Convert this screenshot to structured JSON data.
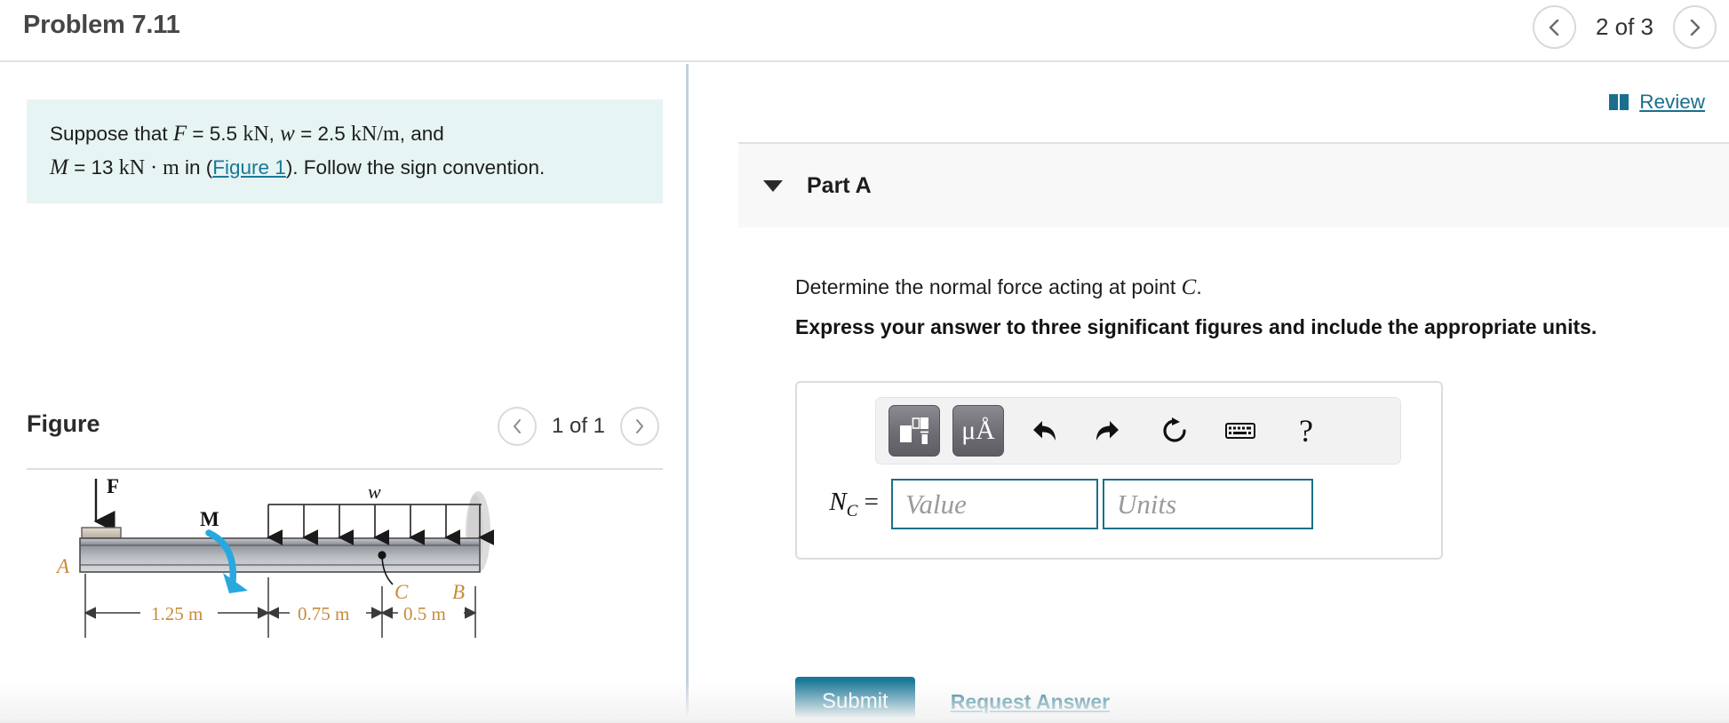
{
  "header": {
    "problem_title": "Problem 7.11",
    "prev_icon": "chevron-left-icon",
    "next_icon": "chevron-right-icon",
    "counter": "2 of 3"
  },
  "left_panel": {
    "statement": {
      "prefix": "Suppose that ",
      "var_F": "F",
      "eq1": " = 5.5 ",
      "unit_kN": "kN",
      "comma1": ", ",
      "var_w": "w",
      "eq2": " = 2.5 ",
      "unit_kNm": "kN/m",
      "and": ", and",
      "var_M": "M",
      "eq3": " = 13 ",
      "unit_kNdotm": "kN · m",
      "in_text": " in (",
      "figure_link": "Figure 1",
      "suffix": "). Follow the sign convention."
    },
    "figure": {
      "title": "Figure",
      "prev_icon": "chevron-left-icon",
      "next_icon": "chevron-right-icon",
      "counter": "1 of 1",
      "labels": {
        "force_F": "F",
        "moment_M": "M",
        "dist_load_w": "w",
        "point_A": "A",
        "point_B": "B",
        "point_C": "C",
        "dim1": "1.25 m",
        "dim2": "0.75 m",
        "dim3": "0.5 m"
      }
    }
  },
  "right_panel": {
    "review": {
      "icon": "book-icon",
      "label": "Review"
    },
    "part": {
      "caret_icon": "caret-down-icon",
      "label": "Part A",
      "question": "Determine the normal force acting at point ",
      "question_var": "C",
      "question_end": ".",
      "instruction": "Express your answer to three significant figures and include the appropriate units."
    },
    "answer": {
      "toolbar": [
        {
          "name": "math-template-icon",
          "glyph": "template"
        },
        {
          "name": "units-icon",
          "glyph": "μÅ"
        },
        {
          "name": "undo-icon",
          "glyph": "↶"
        },
        {
          "name": "redo-icon",
          "glyph": "↷"
        },
        {
          "name": "reset-icon",
          "glyph": "↻"
        },
        {
          "name": "keyboard-icon",
          "glyph": "⌨"
        },
        {
          "name": "help-icon",
          "glyph": "?"
        }
      ],
      "label_N": "N",
      "label_sub": "C",
      "label_eq": " =",
      "value_placeholder": "Value",
      "value_current": "",
      "units_placeholder": "Units",
      "units_current": ""
    },
    "actions": {
      "submit_label": "Submit",
      "request_answer_label": "Request Answer"
    }
  },
  "colors": {
    "accent_teal": "#1a7898",
    "link_teal": "#1a6f8c",
    "statement_bg": "#e6f4f3",
    "part_bg": "#f8f8f8",
    "divider": "#c3d0dd",
    "arrow_blue": "#29a8e0"
  }
}
